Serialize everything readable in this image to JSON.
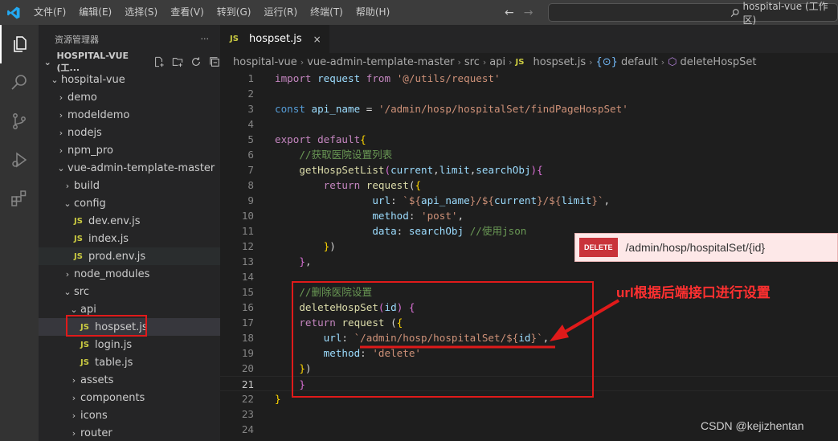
{
  "titlebar": {
    "menu": [
      "文件(F)",
      "编辑(E)",
      "选择(S)",
      "查看(V)",
      "转到(G)",
      "运行(R)",
      "终端(T)",
      "帮助(H)"
    ],
    "back": "←",
    "forward": "→",
    "search_text": "hospital-vue (工作区)"
  },
  "activity": [
    "explorer-icon",
    "search-icon",
    "source-control-icon",
    "run-debug-icon",
    "extensions-icon"
  ],
  "sidebar": {
    "title": "资源管理器",
    "more": "···",
    "section": "HOSPITAL-VUE (工...",
    "tree": [
      {
        "label": "hospital-vue",
        "kind": "folder-open",
        "depth": 0
      },
      {
        "label": "demo",
        "kind": "folder",
        "depth": 1
      },
      {
        "label": "modeldemo",
        "kind": "folder",
        "depth": 1
      },
      {
        "label": "nodejs",
        "kind": "folder",
        "depth": 1
      },
      {
        "label": "npm_pro",
        "kind": "folder",
        "depth": 1
      },
      {
        "label": "vue-admin-template-master",
        "kind": "folder-open",
        "depth": 1
      },
      {
        "label": "build",
        "kind": "folder",
        "depth": 2
      },
      {
        "label": "config",
        "kind": "folder-open",
        "depth": 2
      },
      {
        "label": "dev.env.js",
        "kind": "js",
        "depth": 3
      },
      {
        "label": "index.js",
        "kind": "js",
        "depth": 3
      },
      {
        "label": "prod.env.js",
        "kind": "js",
        "depth": 3
      },
      {
        "label": "node_modules",
        "kind": "folder",
        "depth": 2
      },
      {
        "label": "src",
        "kind": "folder-open",
        "depth": 2
      },
      {
        "label": "api",
        "kind": "folder-open",
        "depth": 3
      },
      {
        "label": "hospset.js",
        "kind": "js",
        "depth": 4
      },
      {
        "label": "login.js",
        "kind": "js",
        "depth": 4
      },
      {
        "label": "table.js",
        "kind": "js",
        "depth": 4
      },
      {
        "label": "assets",
        "kind": "folder",
        "depth": 3
      },
      {
        "label": "components",
        "kind": "folder",
        "depth": 3
      },
      {
        "label": "icons",
        "kind": "folder",
        "depth": 3
      },
      {
        "label": "router",
        "kind": "folder",
        "depth": 3
      }
    ],
    "selected_index": 14,
    "dim_index": 10
  },
  "editor": {
    "tab_label": "hospset.js",
    "tab_badge": "JS",
    "tab_close": "×",
    "breadcrumb": [
      "hospital-vue",
      "vue-admin-template-master",
      "src",
      "api",
      "hospset.js",
      "default",
      "deleteHospSet"
    ],
    "current_line": 21,
    "lines": [
      [
        [
          "kw2",
          "import"
        ],
        [
          "plain",
          " "
        ],
        [
          "var",
          "request"
        ],
        [
          "plain",
          " "
        ],
        [
          "kw2",
          "from"
        ],
        [
          "plain",
          " "
        ],
        [
          "str",
          "'@/utils/request'"
        ]
      ],
      [],
      [
        [
          "kw",
          "const"
        ],
        [
          "plain",
          " "
        ],
        [
          "var",
          "api_name"
        ],
        [
          "plain",
          " = "
        ],
        [
          "str",
          "'/admin/hosp/hospitalSet/findPageHospSet'"
        ]
      ],
      [],
      [
        [
          "kw2",
          "export"
        ],
        [
          "plain",
          " "
        ],
        [
          "kw2",
          "default"
        ],
        [
          "brk",
          "{"
        ]
      ],
      [
        [
          "plain",
          "    "
        ],
        [
          "cm",
          "//获取医院设置列表"
        ]
      ],
      [
        [
          "plain",
          "    "
        ],
        [
          "fn",
          "getHospSetList"
        ],
        [
          "brk2",
          "("
        ],
        [
          "var",
          "current"
        ],
        [
          "plain",
          ","
        ],
        [
          "var",
          "limit"
        ],
        [
          "plain",
          ","
        ],
        [
          "var",
          "searchObj"
        ],
        [
          "brk2",
          ")"
        ],
        [
          "brk2",
          "{"
        ]
      ],
      [
        [
          "plain",
          "        "
        ],
        [
          "kw2",
          "return"
        ],
        [
          "plain",
          " "
        ],
        [
          "fn",
          "request"
        ],
        [
          "plain",
          "("
        ],
        [
          "brk",
          "{"
        ]
      ],
      [
        [
          "plain",
          "                "
        ],
        [
          "var",
          "url"
        ],
        [
          "plain",
          ": "
        ],
        [
          "str",
          "`${"
        ],
        [
          "var",
          "api_name"
        ],
        [
          "str",
          "}/${"
        ],
        [
          "var",
          "current"
        ],
        [
          "str",
          "}/${"
        ],
        [
          "var",
          "limit"
        ],
        [
          "str",
          "}`"
        ],
        [
          "plain",
          ","
        ]
      ],
      [
        [
          "plain",
          "                "
        ],
        [
          "var",
          "method"
        ],
        [
          "plain",
          ": "
        ],
        [
          "str",
          "'post'"
        ],
        [
          "plain",
          ","
        ]
      ],
      [
        [
          "plain",
          "                "
        ],
        [
          "var",
          "data"
        ],
        [
          "plain",
          ": "
        ],
        [
          "var",
          "searchObj"
        ],
        [
          "plain",
          " "
        ],
        [
          "cm",
          "//使用json"
        ]
      ],
      [
        [
          "plain",
          "        "
        ],
        [
          "brk",
          "}"
        ],
        [
          "plain",
          ")"
        ]
      ],
      [
        [
          "plain",
          "    "
        ],
        [
          "brk2",
          "}"
        ],
        [
          "plain",
          ","
        ]
      ],
      [],
      [
        [
          "plain",
          "    "
        ],
        [
          "cm",
          "//删除医院设置"
        ]
      ],
      [
        [
          "plain",
          "    "
        ],
        [
          "fn",
          "deleteHospSet"
        ],
        [
          "brk2",
          "("
        ],
        [
          "var",
          "id"
        ],
        [
          "brk2",
          ")"
        ],
        [
          "plain",
          " "
        ],
        [
          "brk2",
          "{"
        ]
      ],
      [
        [
          "plain",
          "    "
        ],
        [
          "kw2",
          "return"
        ],
        [
          "plain",
          " "
        ],
        [
          "fn",
          "request"
        ],
        [
          "plain",
          " ("
        ],
        [
          "brk",
          "{"
        ]
      ],
      [
        [
          "plain",
          "        "
        ],
        [
          "var",
          "url"
        ],
        [
          "plain",
          ": "
        ],
        [
          "str",
          "`/admin/hosp/hospitalSet/${"
        ],
        [
          "var",
          "id"
        ],
        [
          "str",
          "}`"
        ],
        [
          "plain",
          ","
        ]
      ],
      [
        [
          "plain",
          "        "
        ],
        [
          "var",
          "method"
        ],
        [
          "plain",
          ": "
        ],
        [
          "str",
          "'delete'"
        ]
      ],
      [
        [
          "plain",
          "    "
        ],
        [
          "brk",
          "}"
        ],
        [
          "plain",
          ")"
        ]
      ],
      [
        [
          "plain",
          "    "
        ],
        [
          "brk2",
          "}"
        ]
      ],
      [
        [
          "brk",
          "}"
        ]
      ],
      [],
      []
    ]
  },
  "annotation": {
    "badge": "DELETE",
    "path": "/admin/hosp/hospitalSet/{id}",
    "note": "url根据后端接口进行设置"
  },
  "watermark": "CSDN @kejizhentan",
  "colors": {
    "accent_red": "#e01a1a",
    "js_yellow": "#cbcb41"
  }
}
